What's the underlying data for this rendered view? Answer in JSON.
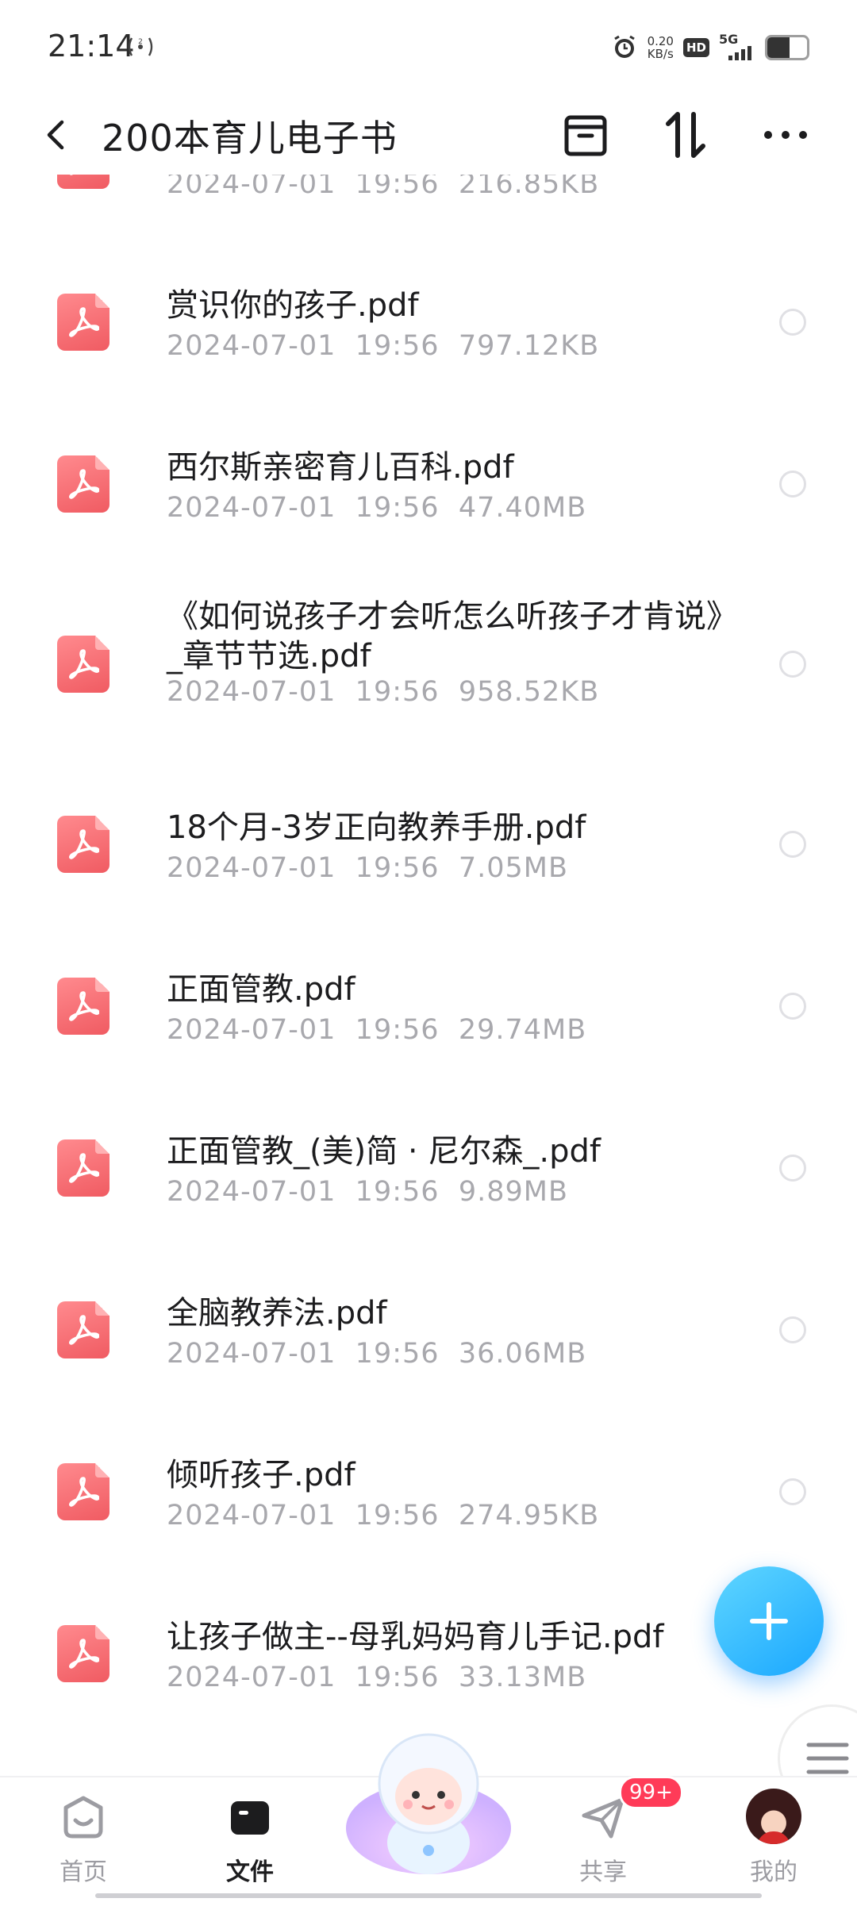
{
  "status_bar": {
    "time": "21:14",
    "net_speed_value": "0.20",
    "net_speed_unit": "KB/s",
    "hd_label": "HD",
    "network_label": "5G",
    "battery_level": 0.55
  },
  "header": {
    "title": "200本育儿电子书",
    "icons": [
      "back-icon",
      "archive-icon",
      "sort-icon",
      "more-icon"
    ]
  },
  "files": [
    {
      "name": ".",
      "date": "2024-07-01",
      "time": "19:56",
      "size": "216.85KB"
    },
    {
      "name": "赏识你的孩子.pdf",
      "date": "2024-07-01",
      "time": "19:56",
      "size": "797.12KB"
    },
    {
      "name": "西尔斯亲密育儿百科.pdf",
      "date": "2024-07-01",
      "time": "19:56",
      "size": "47.40MB"
    },
    {
      "name": "《如何说孩子才会听怎么听孩子才肯说》_章节节选.pdf",
      "date": "2024-07-01",
      "time": "19:56",
      "size": "958.52KB"
    },
    {
      "name": "18个月-3岁正向教养手册.pdf",
      "date": "2024-07-01",
      "time": "19:56",
      "size": "7.05MB"
    },
    {
      "name": "正面管教.pdf",
      "date": "2024-07-01",
      "time": "19:56",
      "size": "29.74MB"
    },
    {
      "name": "正面管教_(美)简 · 尼尔森_.pdf",
      "date": "2024-07-01",
      "time": "19:56",
      "size": "9.89MB"
    },
    {
      "name": "全脑教养法.pdf",
      "date": "2024-07-01",
      "time": "19:56",
      "size": "36.06MB"
    },
    {
      "name": "倾听孩子.pdf",
      "date": "2024-07-01",
      "time": "19:56",
      "size": "274.95KB"
    },
    {
      "name": "让孩子做主--母乳妈妈育儿手记.pdf",
      "date": "2024-07-01",
      "time": "19:56",
      "size": "33.13MB"
    }
  ],
  "nav": {
    "home": "首页",
    "files": "文件",
    "share": "共享",
    "mine": "我的",
    "share_badge": "99+"
  },
  "colors": {
    "accent_blue": "#1aa7ff",
    "pdf_red": "#f05b62",
    "badge_red": "#ff3b58",
    "meta_gray": "#a8a8ad"
  }
}
